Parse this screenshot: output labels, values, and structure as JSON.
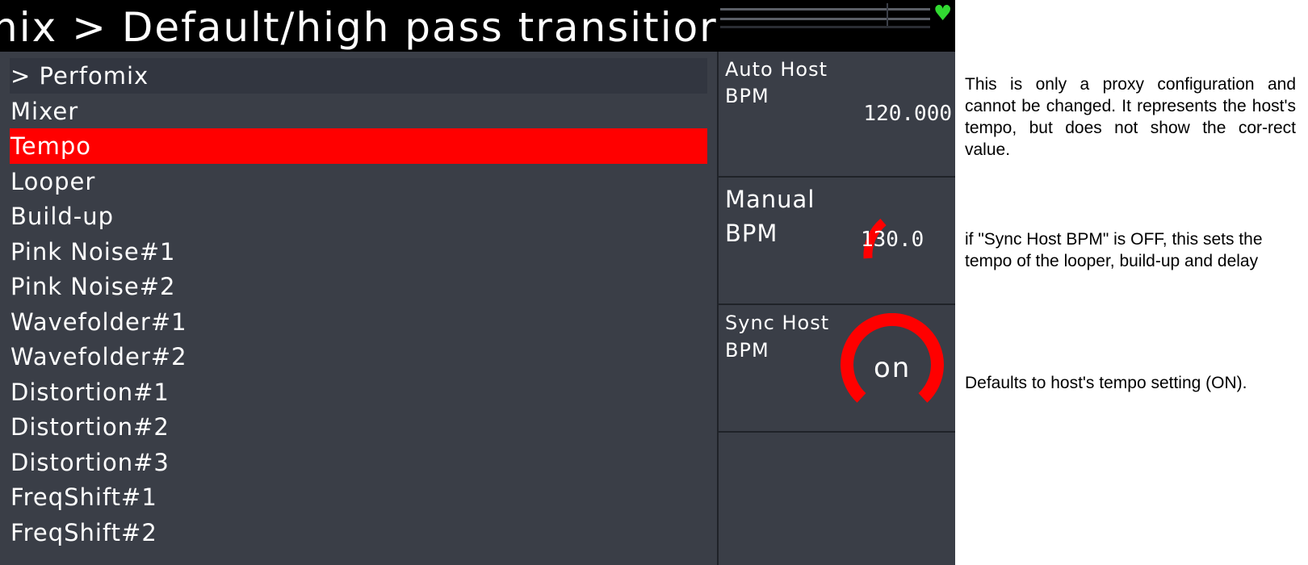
{
  "header": {
    "title": "nix > Default/high pass transitior",
    "status_icon": "heart-icon",
    "status_color": "#31d931"
  },
  "menu": {
    "items": [
      {
        "label": "> Perfomix",
        "state": "header"
      },
      {
        "label": "Mixer",
        "state": "normal"
      },
      {
        "label": "Tempo",
        "state": "selected"
      },
      {
        "label": "Looper",
        "state": "normal"
      },
      {
        "label": "Build-up",
        "state": "normal"
      },
      {
        "label": "Pink Noise#1",
        "state": "normal"
      },
      {
        "label": "Pink Noise#2",
        "state": "normal"
      },
      {
        "label": "Wavefolder#1",
        "state": "normal"
      },
      {
        "label": "Wavefolder#2",
        "state": "normal"
      },
      {
        "label": "Distortion#1",
        "state": "normal"
      },
      {
        "label": "Distortion#2",
        "state": "normal"
      },
      {
        "label": "Distortion#3",
        "state": "normal"
      },
      {
        "label": "FreqShift#1",
        "state": "normal"
      },
      {
        "label": "FreqShift#2",
        "state": "normal"
      }
    ],
    "selected_color": "#ff0000"
  },
  "panel": {
    "auto_host": {
      "label_line1": "Auto Host",
      "label_line2": "BPM",
      "value": "120.000"
    },
    "manual": {
      "label_line1": "Manual",
      "label_line2": "BPM",
      "value": "130.0"
    },
    "sync_host": {
      "label_line1": "Sync Host",
      "label_line2": "BPM",
      "value": "on",
      "state": "ON"
    },
    "accent_color": "#ff0000"
  },
  "notes": {
    "auto_host": "This is only a proxy configuration and cannot be changed. It represents the host's tempo, but does not show the cor-rect value.",
    "manual": "if \"Sync Host BPM\" is OFF, this sets the tempo of the looper, build-up and delay",
    "sync_host": "Defaults to host's tempo setting (ON)."
  }
}
